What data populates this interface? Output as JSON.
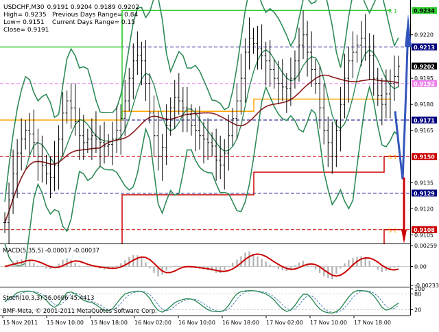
{
  "header": {
    "symbol": "USDCHF,M30",
    "ohlc": "0.9191 0.9204 0.9189 0.9202",
    "high": "High= 0.9235",
    "low": "Low= 0.9151",
    "close": "Close= 0.9191",
    "prev_range": "Previous Days Range= 0.84",
    "curr_range": "Current Days Range= 0.15"
  },
  "colors": {
    "price": "#000000",
    "bands": "#2e8b57",
    "ma": "#8b1a1a",
    "pivot": "#ffa500",
    "resistance": "#33cc33",
    "support": "#cc0000",
    "arrow": "#3355bb",
    "macd_hist": "#b0b0b0",
    "macd_signal": "#cc0000",
    "stoch_main": "#2e8b57",
    "stoch_signal": "#4682b4"
  },
  "chart_data": [
    {
      "type": "line",
      "title": "USDCHF,M30",
      "x_tick_labels": [
        "15 Nov 2011",
        "15 Nov 10:00",
        "15 Nov 18:00",
        "16 Nov 02:00",
        "16 Nov 10:00",
        "16 Nov 18:00",
        "17 Nov 02:00",
        "17 Nov 10:00",
        "17 Nov 18:00"
      ],
      "ylim": [
        0.91,
        0.924
      ],
      "y_ticks": [
        "0.9220",
        "0.9195",
        "0.9180",
        "0.9165",
        "0.9135",
        "0.9120",
        "0.9105"
      ],
      "price_labels": [
        {
          "value": "0.9234",
          "color": "#33cc33",
          "text_color": "#000000"
        },
        {
          "value": "0.9213",
          "color": "#000080",
          "text_color": "#ffffff"
        },
        {
          "value": "0.9202",
          "color": "#000000",
          "text_color": "#ffffff"
        },
        {
          "value": "0.9192",
          "color": "#ee82ee",
          "text_color": "#ffffff"
        },
        {
          "value": "0.9171",
          "color": "#000080",
          "text_color": "#ffffff"
        },
        {
          "value": "0.9150",
          "color": "#cc0000",
          "text_color": "#ffffff"
        },
        {
          "value": "0.9129",
          "color": "#000080",
          "text_color": "#ffffff"
        },
        {
          "value": "0.9108",
          "color": "#cc0000",
          "text_color": "#ffffff"
        }
      ],
      "level_labels": [
        "R 1",
        "S 1",
        "S 2"
      ],
      "close_series": [
        0.9112,
        0.9125,
        0.914,
        0.9152,
        0.916,
        0.9165,
        0.9163,
        0.9158,
        0.915,
        0.9145,
        0.914,
        0.9138,
        0.9145,
        0.916,
        0.9175,
        0.9182,
        0.9178,
        0.917,
        0.9162,
        0.9158,
        0.916,
        0.9162,
        0.916,
        0.9158,
        0.9156,
        0.9157,
        0.916,
        0.9165,
        0.9172,
        0.9182,
        0.9195,
        0.9205,
        0.9208,
        0.9205,
        0.9192,
        0.9175,
        0.9162,
        0.915,
        0.9155,
        0.9168,
        0.9178,
        0.9184,
        0.9182,
        0.9178,
        0.9174,
        0.9168,
        0.9165,
        0.9162,
        0.916,
        0.9158,
        0.9156,
        0.9148,
        0.9145,
        0.9152,
        0.9162,
        0.9172,
        0.9182,
        0.9195,
        0.921,
        0.9218,
        0.9215,
        0.9212,
        0.9208,
        0.9205,
        0.92,
        0.9195,
        0.9192,
        0.919,
        0.9189,
        0.9195,
        0.9205,
        0.9214,
        0.922,
        0.921,
        0.92,
        0.9192,
        0.9178,
        0.9165,
        0.9158,
        0.915,
        0.9165,
        0.918,
        0.9195,
        0.9205,
        0.921,
        0.9214,
        0.9218,
        0.9213,
        0.9208,
        0.9195,
        0.9185,
        0.918,
        0.9186,
        0.9192,
        0.9196,
        0.9202
      ]
    },
    {
      "type": "bar",
      "title": "MACD(5,35,5) -0.00017 -0.00037",
      "ylim": [
        -0.00233,
        0.00259
      ],
      "y_ticks": [
        "0.00259",
        "0.00",
        "-0.00233"
      ]
    },
    {
      "type": "line",
      "title": "Stoch(10,3,3) 56.0606 45.4413",
      "ylim": [
        0,
        100
      ],
      "y_ticks": [
        "100",
        "80",
        "20"
      ]
    }
  ],
  "footer": {
    "copyright": "BMF-Meta, © 2001-2011 MetaQuotes Software Corp."
  }
}
